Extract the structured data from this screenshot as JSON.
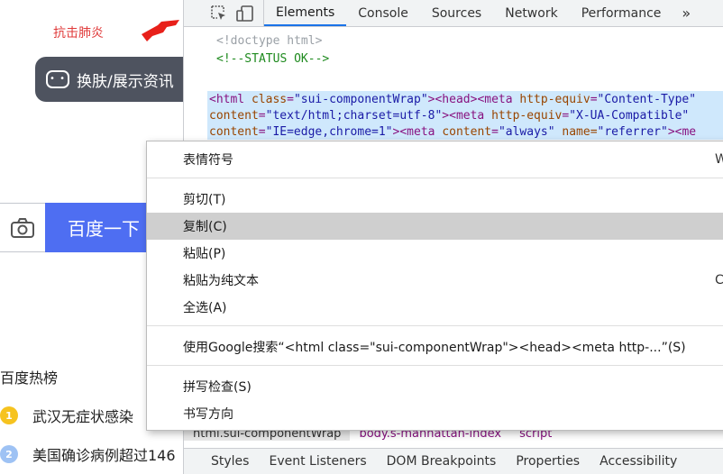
{
  "page": {
    "promo_text": "抗击肺炎",
    "skin_label": "换肤/展示资讯",
    "search_button": "百度一下",
    "hot_title": "百度热榜",
    "hot_items": [
      {
        "rank": "1",
        "text": "武汉无症状感染",
        "color": "#f6c31f"
      },
      {
        "rank": "2",
        "text": "美国确诊病例超过146",
        "color": "#9ec2f4"
      }
    ]
  },
  "devtools": {
    "tabs": [
      "Elements",
      "Console",
      "Sources",
      "Network",
      "Performance"
    ],
    "more": "»",
    "dom": {
      "doctype": "<!doctype html>",
      "comment": "<!--STATUS OK-->",
      "line1": {
        "t1": "<html ",
        "a1": "class",
        "v1": "\"sui-componentWrap\"",
        "t2": "><head><meta ",
        "a2": "http-equiv",
        "v2": "\"Content-Type\""
      },
      "line2": {
        "a1": "content",
        "v1": "\"text/html;charset=utf-8\"",
        "t1": "><meta ",
        "a2": "http-equiv",
        "v2": "\"X-UA-Compatible\""
      },
      "line3": {
        "a1": "content",
        "v1": "\"IE=edge,chrome=1\"",
        "t1": "><meta ",
        "a2": "content",
        "v2": "\"always\"",
        "t2": " name=",
        "v3": "\"referrer\"",
        "t3": "><me"
      }
    },
    "crumbs": [
      "html.sui-componentWrap",
      "body.s-manhattan-index",
      "script"
    ],
    "subtabs": [
      "Styles",
      "Event Listeners",
      "DOM Breakpoints",
      "Properties",
      "Accessibility"
    ]
  },
  "context_menu": {
    "items": [
      {
        "label": "表情符号",
        "shortcut": "W"
      },
      {
        "label": "剪切(T)",
        "shortcut": ""
      },
      {
        "label": "复制(C)",
        "shortcut": ""
      },
      {
        "label": "粘贴(P)",
        "shortcut": ""
      },
      {
        "label": "粘贴为纯文本",
        "shortcut": "C"
      },
      {
        "label": "全选(A)",
        "shortcut": ""
      },
      {
        "label": "使用Google搜索“<html class=\"sui-componentWrap\"><head><meta http-...”(S)",
        "shortcut": ""
      },
      {
        "label": "拼写检查(S)",
        "shortcut": ""
      },
      {
        "label": "书写方向",
        "shortcut": ""
      }
    ],
    "highlighted_index": 2
  },
  "colors": {
    "accent": "#1a73e8",
    "search_blue": "#4e6ef2",
    "menu_highlight": "#cfcfcf",
    "promo_red": "#e03a3a"
  }
}
